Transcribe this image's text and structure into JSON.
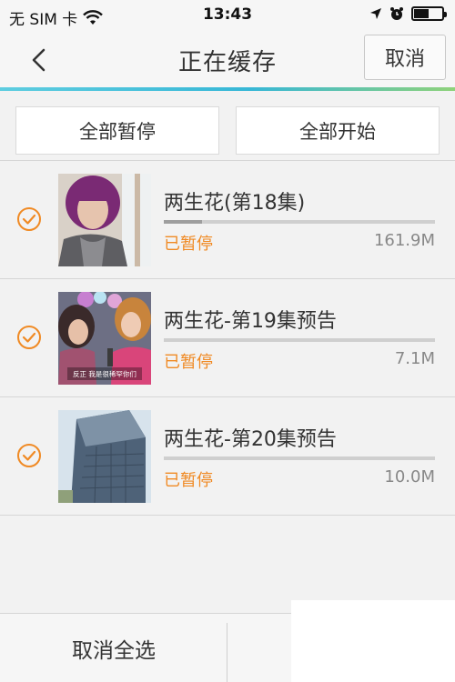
{
  "status_bar": {
    "carrier": "无 SIM 卡",
    "time": "13:43"
  },
  "nav": {
    "title": "正在缓存",
    "cancel_label": "取消"
  },
  "actions": {
    "pause_all": "全部暂停",
    "start_all": "全部开始"
  },
  "items": [
    {
      "title": "两生花(第18集)",
      "status": "已暂停",
      "size": "161.9M",
      "progress": 0.14
    },
    {
      "title": "两生花-第19集预告",
      "status": "已暂停",
      "size": "7.1M",
      "progress": 0.0
    },
    {
      "title": "两生花-第20集预告",
      "status": "已暂停",
      "size": "10.0M",
      "progress": 0.0
    }
  ],
  "thumb_caption": "反正 我是很稀罕你们",
  "bottom": {
    "deselect_all": "取消全选"
  },
  "colors": {
    "accent_orange": "#f08a24",
    "accent_gradient_start": "#5ecde0",
    "accent_gradient_end": "#8fd27a"
  },
  "icons": {
    "back": "chevron-left-icon",
    "check": "check-circle-icon",
    "wifi": "wifi-icon",
    "location": "location-arrow-icon",
    "alarm": "alarm-icon",
    "battery": "battery-icon"
  }
}
